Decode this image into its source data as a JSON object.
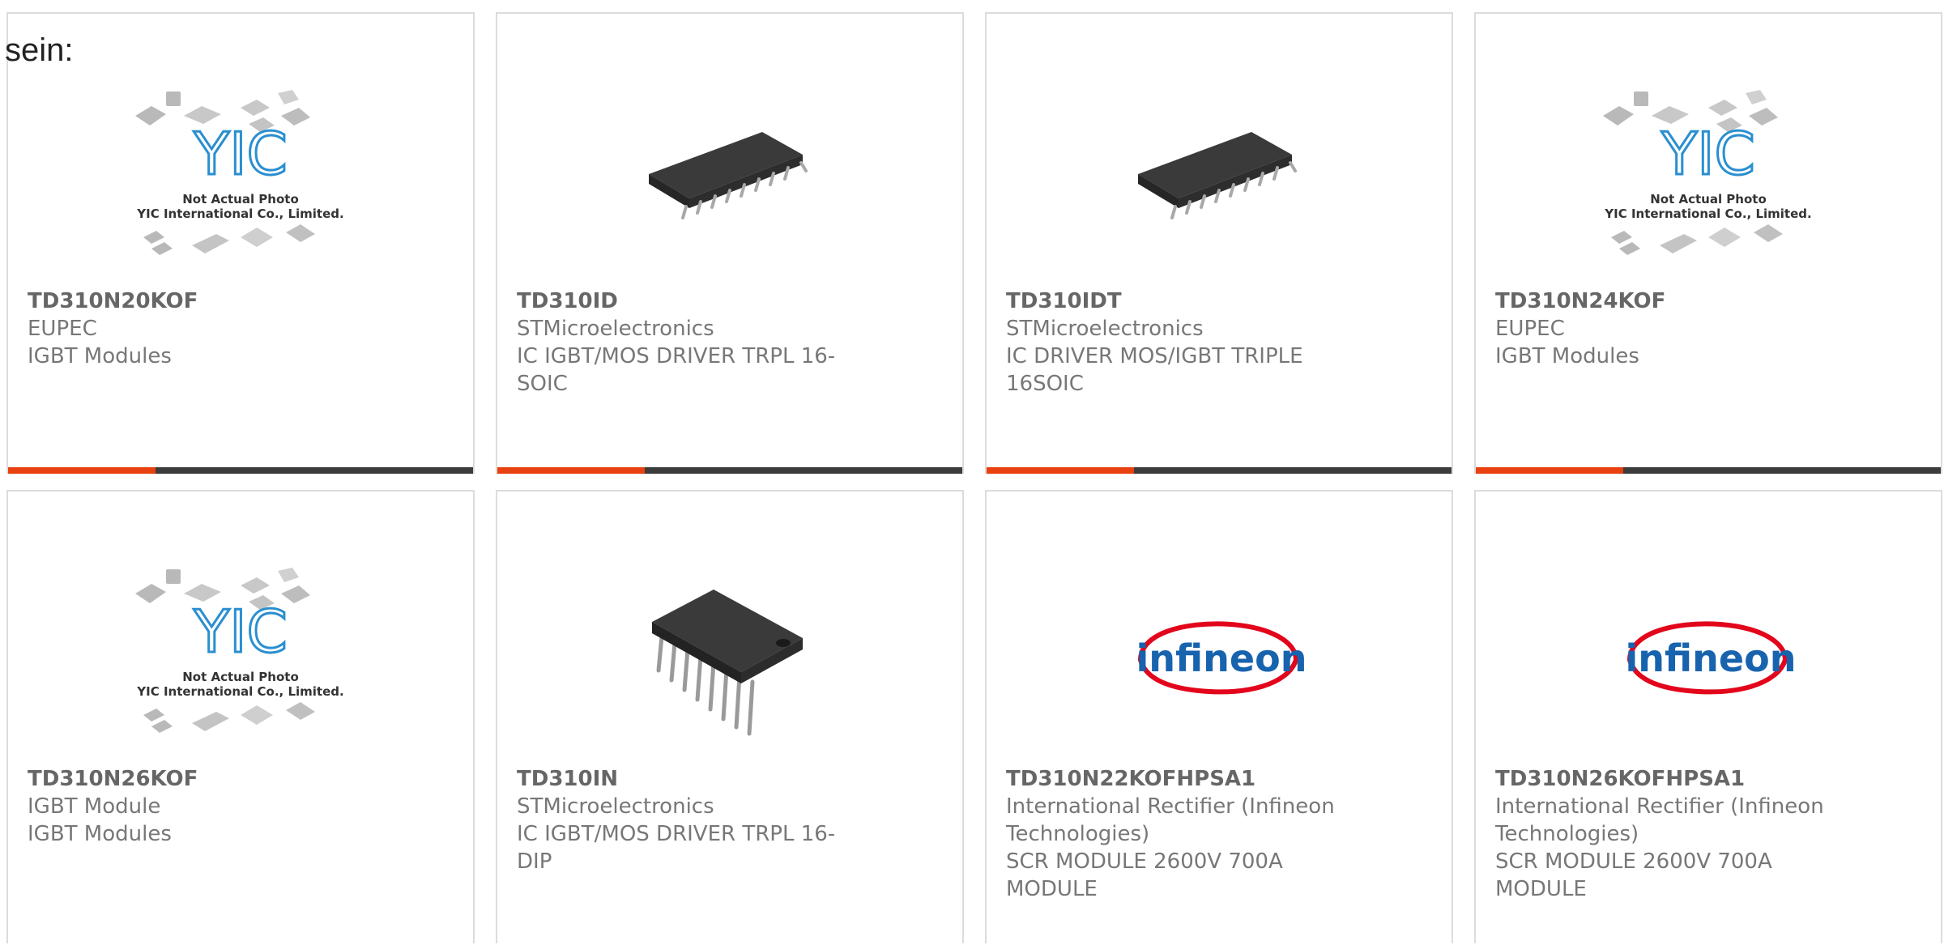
{
  "intro_text": "sein:",
  "colors": {
    "accent": "#e8410f",
    "bar": "#3c3c3c",
    "card_border": "#dcdcdc",
    "text": "#777777",
    "yic_blue": "#2a8fd0",
    "infineon_blue": "#1763ae",
    "infineon_red": "#e3051b"
  },
  "products": [
    {
      "part": "TD310N20KOF",
      "manufacturer": "EUPEC",
      "description": "IGBT Modules",
      "image": "yic-placeholder",
      "image_text": [
        "Not Actual Photo",
        "YIC International Co., Limited."
      ]
    },
    {
      "part": "TD310ID",
      "manufacturer": "STMicroelectronics",
      "description": "IC IGBT/MOS DRIVER TRPL 16-SOIC",
      "image": "soic-chip"
    },
    {
      "part": "TD310IDT",
      "manufacturer": "STMicroelectronics",
      "description": "IC DRIVER MOS/IGBT TRIPLE 16SOIC",
      "image": "soic-chip"
    },
    {
      "part": "TD310N24KOF",
      "manufacturer": "EUPEC",
      "description": "IGBT Modules",
      "image": "yic-placeholder",
      "image_text": [
        "Not Actual Photo",
        "YIC International Co., Limited."
      ]
    },
    {
      "part": "TD310N26KOF",
      "manufacturer": "IGBT Module",
      "description": "IGBT Modules",
      "image": "yic-placeholder",
      "image_text": [
        "Not Actual Photo",
        "YIC International Co., Limited."
      ]
    },
    {
      "part": "TD310IN",
      "manufacturer": "STMicroelectronics",
      "description": "IC IGBT/MOS DRIVER TRPL 16-DIP",
      "image": "dip-chip"
    },
    {
      "part": "TD310N22KOFHPSA1",
      "manufacturer": "International Rectifier (Infineon Technologies)",
      "description": "SCR MODULE 2600V 700A MODULE",
      "image": "infineon-logo",
      "logo_text": "infineon"
    },
    {
      "part": "TD310N26KOFHPSA1",
      "manufacturer": "International Rectifier (Infineon Technologies)",
      "description": "SCR MODULE 2600V 700A MODULE",
      "image": "infineon-logo",
      "logo_text": "infineon"
    }
  ]
}
